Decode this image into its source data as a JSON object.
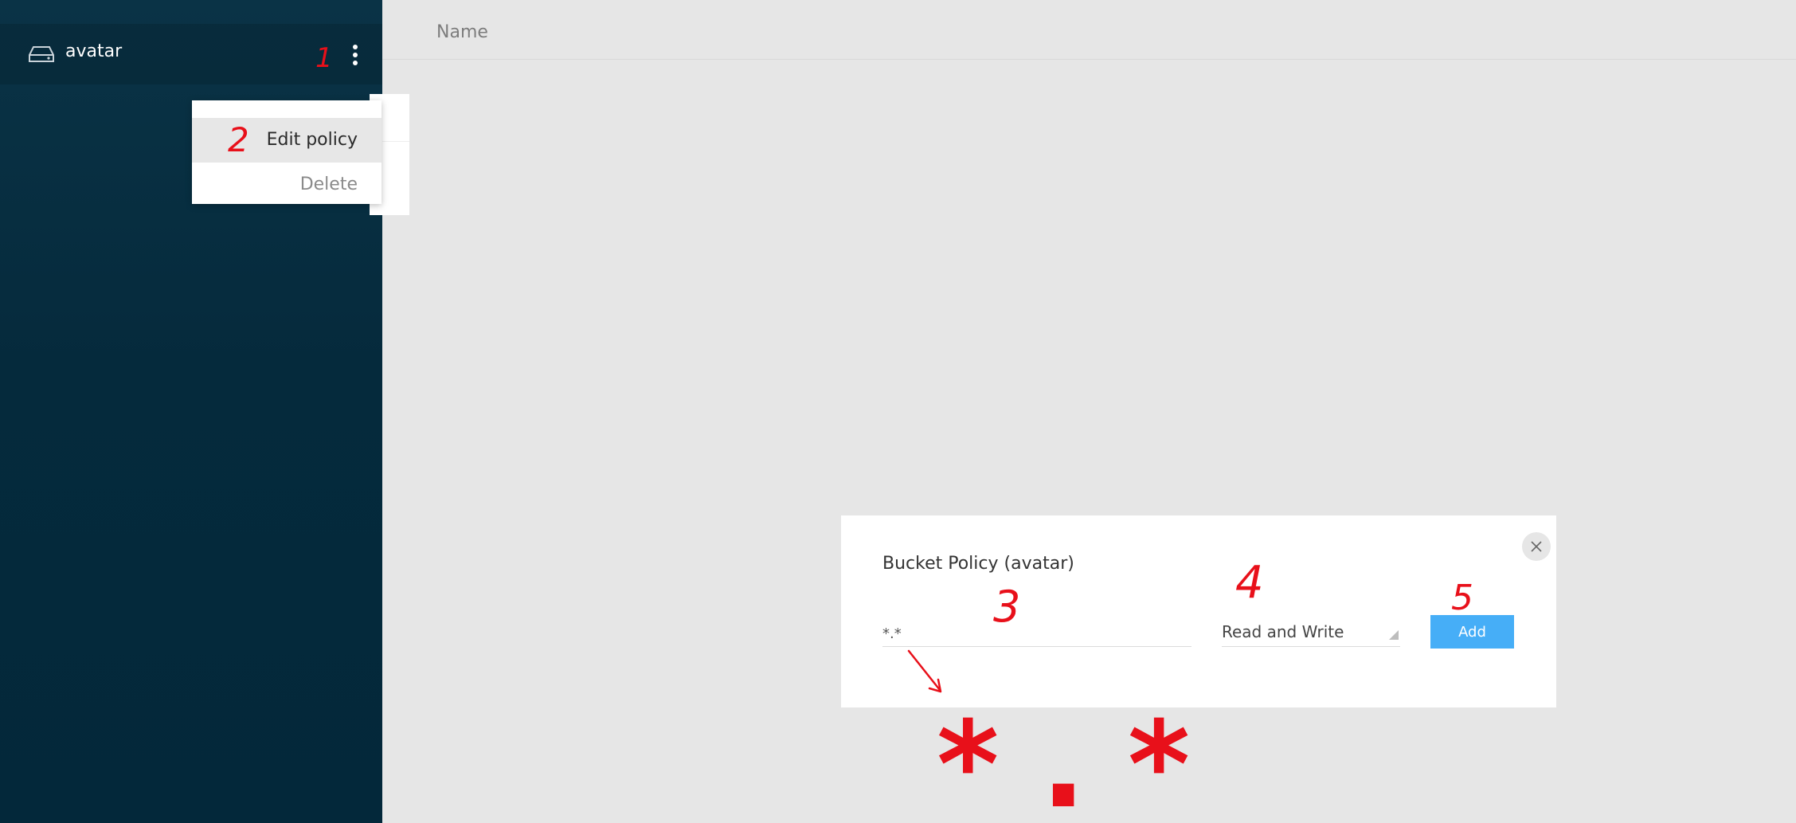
{
  "sidebar": {
    "bucket": {
      "name": "avatar",
      "icon": "drive-icon"
    },
    "menu_icon": "kebab-menu-icon"
  },
  "context_menu": {
    "items": [
      {
        "label": "Edit policy"
      },
      {
        "label": "Delete"
      }
    ]
  },
  "main": {
    "column_header": "Name"
  },
  "modal": {
    "title": "Bucket Policy (avatar)",
    "prefix_value": "*.*",
    "policy_selected": "Read and Write",
    "add_label": "Add",
    "close_icon": "close-icon"
  },
  "annotations": {
    "color": "#e8101a",
    "step_1": "1",
    "step_2": "2",
    "step_3": "3",
    "step_4": "4",
    "step_5": "5",
    "hint": "* . *"
  },
  "colors": {
    "sidebar": "#052a3c",
    "accent_button": "#46aef7",
    "background": "#e6e6e6"
  }
}
